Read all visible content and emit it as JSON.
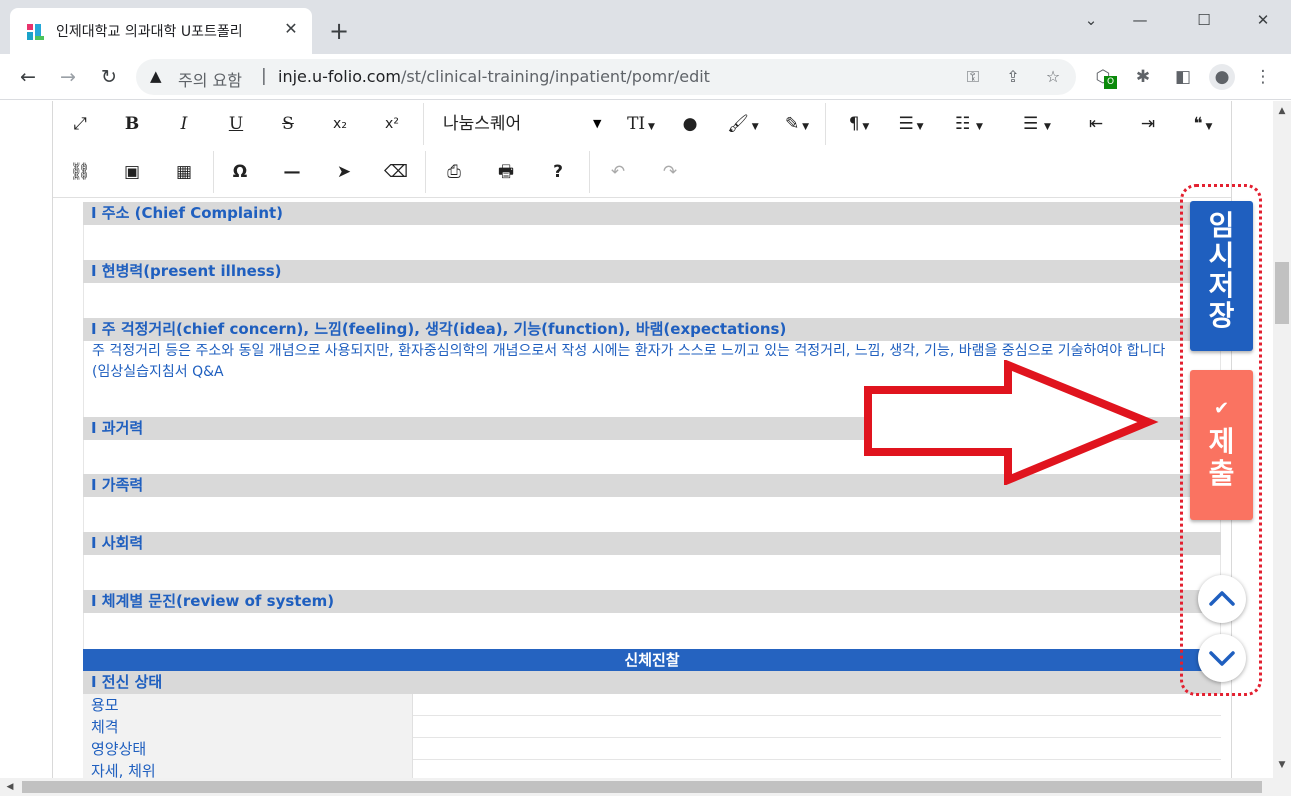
{
  "browser": {
    "tab_title": "인제대학교 의과대학 U포트폴리",
    "tab_close": "✕",
    "new_tab": "+",
    "security_label": "주의 요함",
    "separator": "|",
    "url_host": "inje.u-folio.com",
    "url_path": "/st/clinical-training/inpatient/pomr/edit",
    "extension_badge": "O"
  },
  "editor_toolbar": {
    "font_name": "나눔스퀘어",
    "bold": "B",
    "italic": "I",
    "underline": "U",
    "strikethrough": "S",
    "subscript": "x₂",
    "superscript": "x²",
    "text_size": "TI",
    "paragraph": "¶",
    "special_char": "Ω",
    "help": "?",
    "quote": "❝"
  },
  "sections": [
    {
      "title": "I 주소 (Chief Complaint)"
    },
    {
      "title": "I 현병력(present illness)"
    },
    {
      "title": "I 주 걱정거리(chief concern), 느낌(feeling), 생각(idea), 기능(function), 바램(expectations)",
      "note": "주 걱정거리 등은 주소와 동일 개념으로 사용되지만, 환자중심의학의 개념으로서 작성 시에는 환자가 스스로 느끼고 있는 걱정거리, 느낌, 생각, 기능, 바램을 중심으로 기술하여야 합니다",
      "note2": "(임상실습지침서 Q&A"
    },
    {
      "title": "I 과거력"
    },
    {
      "title": "I 가족력"
    },
    {
      "title": "I 사회력"
    },
    {
      "title": "I 체계별 문진(review of system)"
    }
  ],
  "physical_exam": {
    "header": "신체진찰",
    "subsection": "I 전신 상태",
    "rows": [
      "용모",
      "체격",
      "영양상태",
      "자세, 체위"
    ]
  },
  "floating_panel": {
    "temp_save": [
      "임",
      "시",
      "저",
      "장"
    ],
    "submit_check": "✔",
    "submit": [
      "제",
      "출"
    ]
  }
}
